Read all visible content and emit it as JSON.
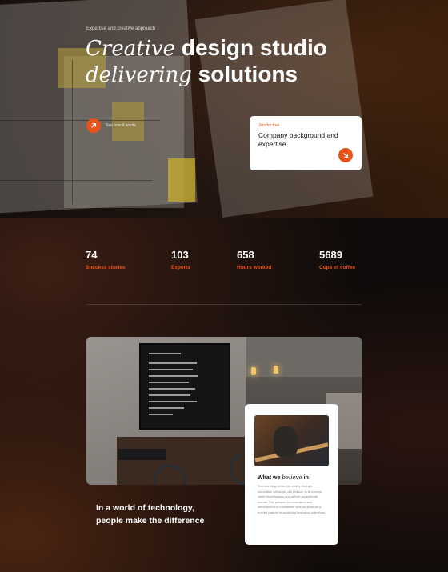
{
  "hero": {
    "eyebrow": "Expertise and creative approach",
    "headline_line1_italic": "Creative",
    "headline_line1_bold": "design studio",
    "headline_line2_italic": "delivering",
    "headline_line2_bold": "solutions",
    "cta_label": "See how it works",
    "cta_icon": "arrow-up-right-icon"
  },
  "join_card": {
    "tag": "Join for free",
    "title": "Company background and expertise",
    "button_icon": "arrow-down-right-icon"
  },
  "stats": [
    {
      "value": "74",
      "label": "Success stories"
    },
    {
      "value": "103",
      "label": "Experts"
    },
    {
      "value": "658",
      "label": "Hours worked"
    },
    {
      "value": "5689",
      "label": "Cups of coffee"
    }
  ],
  "caption": {
    "line1": "In a world of technology,",
    "line2": "people make the difference"
  },
  "believe_card": {
    "heading_prefix": "What we",
    "heading_italic": "believe",
    "heading_suffix": "in",
    "body": "Transforming ideas into reality through innovative solutions, our mission is to exceed client expectations and deliver exceptional results. Our passion for innovation and commitment to excellence sets us apart as a trusted partner in achieving business objectives."
  },
  "colors": {
    "accent": "#e8531c",
    "background": "#0f0b0a",
    "card": "#ffffff"
  }
}
